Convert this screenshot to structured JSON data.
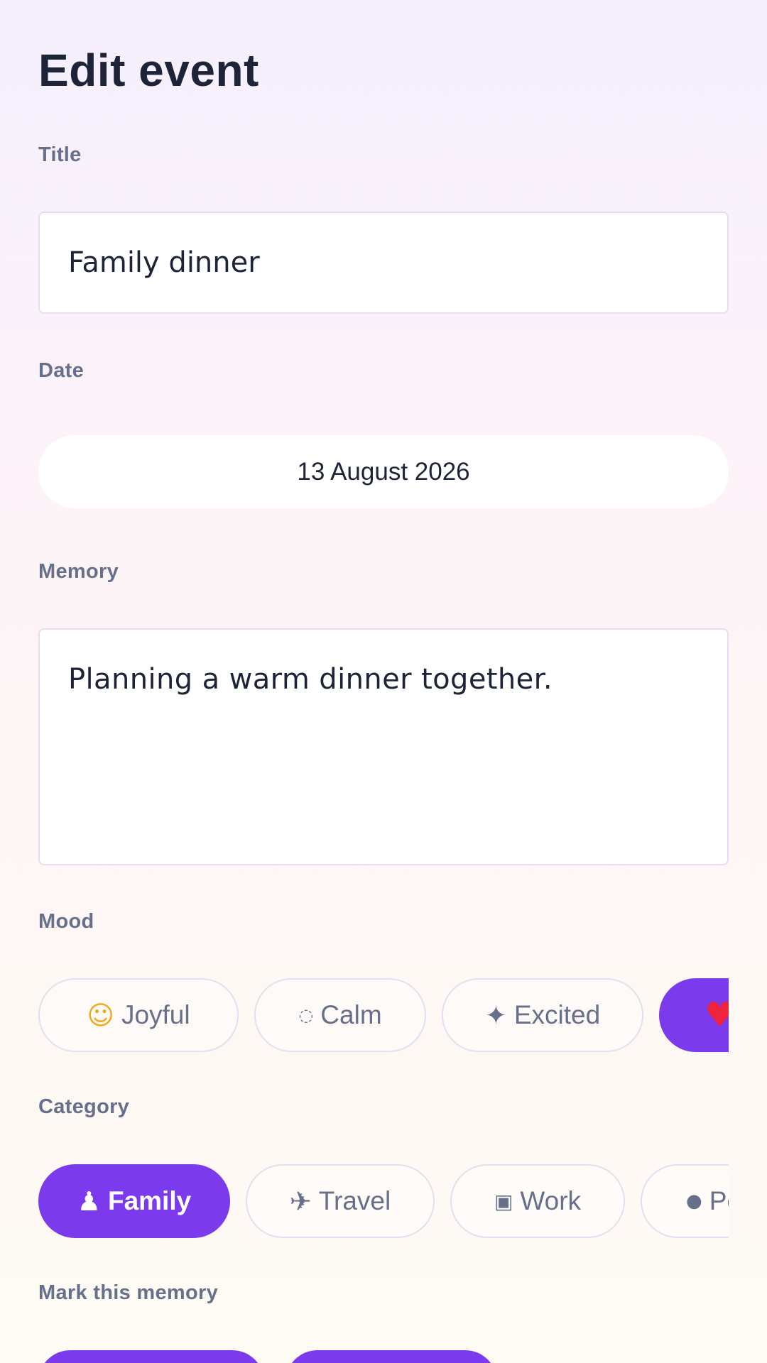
{
  "page": {
    "title": "Edit event"
  },
  "fields": {
    "title": {
      "label": "Title",
      "value": "Family dinner"
    },
    "date": {
      "label": "Date",
      "value": "13 August 2026"
    },
    "memory": {
      "label": "Memory",
      "value": "Planning a warm dinner together."
    }
  },
  "mood": {
    "label": "Mood",
    "options": [
      {
        "icon": "☺",
        "icon_name": "smiling-face-icon",
        "label": "Joyful",
        "selected": false
      },
      {
        "icon": "◌",
        "icon_name": "circle-icon",
        "label": "Calm",
        "selected": false
      },
      {
        "icon": "✦",
        "icon_name": "sparkle-icon",
        "label": "Excited",
        "selected": false
      },
      {
        "icon": "♥",
        "icon_name": "heart-icon",
        "label": "",
        "selected": true
      }
    ]
  },
  "category": {
    "label": "Category",
    "options": [
      {
        "icon": "♟",
        "icon_name": "person-icon",
        "label": "Family",
        "selected": true
      },
      {
        "icon": "✈",
        "icon_name": "airplane-icon",
        "label": "Travel",
        "selected": false
      },
      {
        "icon": "▣",
        "icon_name": "briefcase-icon",
        "label": "Work",
        "selected": false
      },
      {
        "icon": "●",
        "icon_name": "dot-icon",
        "label": "Pe",
        "selected": false
      }
    ]
  },
  "mark": {
    "label": "Mark this memory"
  },
  "colors": {
    "accent": "#7c3aed",
    "heart": "#ef233c",
    "label": "#66708a",
    "text": "#1e2438"
  }
}
